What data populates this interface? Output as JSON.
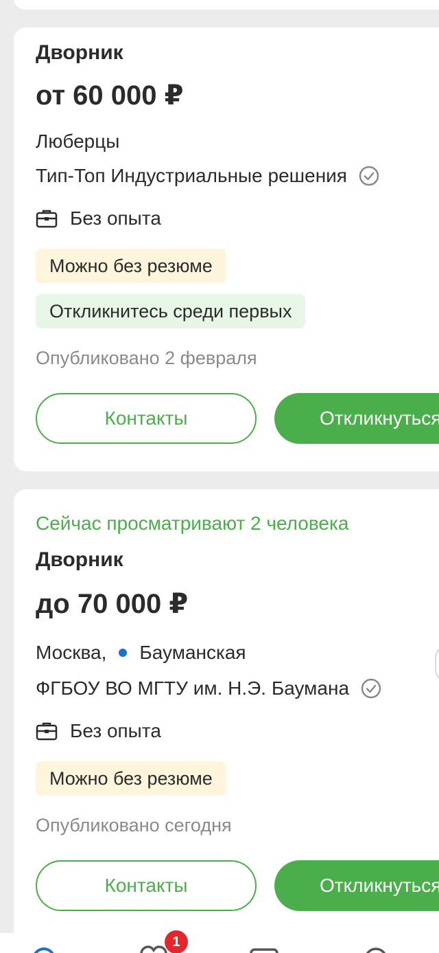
{
  "vacancies": [
    {
      "title": "Дворник",
      "salary": "от 60 000 ₽",
      "city": "Люберцы",
      "company": "Тип-Топ Индустриальные решения",
      "experience": "Без опыта",
      "tags": [
        "Можно без резюме",
        "Откликнитесь среди первых"
      ],
      "published": "Опубликовано 2 февраля",
      "contacts_label": "Контакты",
      "respond_label": "Откликнуться"
    },
    {
      "viewers": "Сейчас просматривают 2 человека",
      "title": "Дворник",
      "salary": "до 70 000 ₽",
      "city": "Москва,",
      "metro": "Бауманская",
      "company": "ФГБОУ ВО МГТУ им. Н.Э. Баумана",
      "experience": "Без опыта",
      "tags": [
        "Можно без резюме"
      ],
      "published": "Опубликовано сегодня",
      "contacts_label": "Контакты",
      "respond_label": "Откликнуться"
    }
  ],
  "bottom_nav": {
    "favorites_badge": "1",
    "icons": [
      "search-icon",
      "favorites-icon",
      "responses-icon",
      "profile-icon"
    ]
  },
  "colors": {
    "accent": "#4aae4b",
    "tag_yellow": "#fff5dc",
    "tag_green": "#e8f6e8",
    "metro": "#1a73c8",
    "badge": "#e2282d"
  }
}
